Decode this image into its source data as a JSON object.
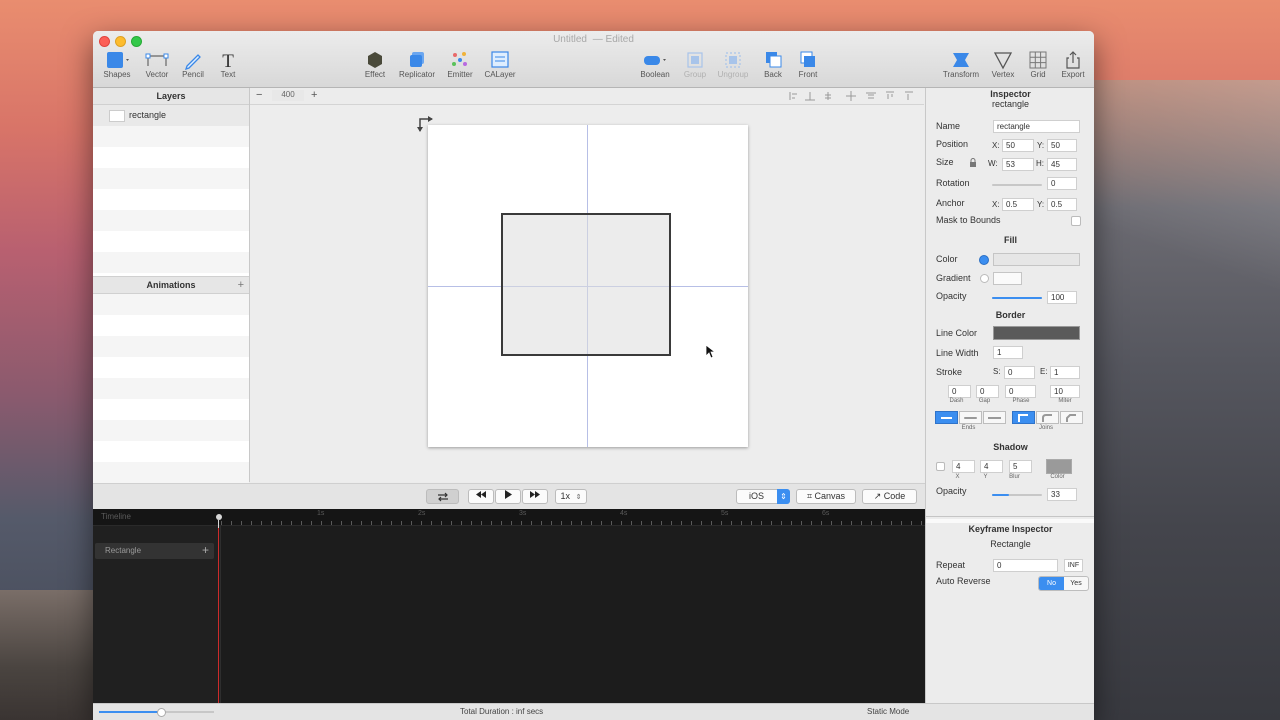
{
  "window": {
    "title": "Untitled",
    "subtitle": "— Edited"
  },
  "toolbar": {
    "shapes": "Shapes",
    "vector": "Vector",
    "pencil": "Pencil",
    "text": "Text",
    "effect": "Effect",
    "replicator": "Replicator",
    "emitter": "Emitter",
    "calayer": "CALayer",
    "boolean": "Boolean",
    "group": "Group",
    "ungroup": "Ungroup",
    "back": "Back",
    "front": "Front",
    "transform": "Transform",
    "vertex": "Vertex",
    "grid": "Grid",
    "export": "Export"
  },
  "layers": {
    "header": "Layers",
    "items": [
      {
        "name": "rectangle"
      }
    ]
  },
  "animations": {
    "header": "Animations",
    "add": "+"
  },
  "canvas": {
    "zoom_minus": "−",
    "zoom_value": "400",
    "zoom_plus": "+"
  },
  "inspector": {
    "title": "Inspector",
    "subtitle": "rectangle",
    "name_label": "Name",
    "name_value": "rectangle",
    "position_label": "Position",
    "pos_x_label": "X:",
    "pos_x": "50",
    "pos_y_label": "Y:",
    "pos_y": "50",
    "size_label": "Size",
    "w_label": "W:",
    "w": "53",
    "h_label": "H:",
    "h": "45",
    "rotation_label": "Rotation",
    "rotation": "0",
    "anchor_label": "Anchor",
    "anchor_x_label": "X:",
    "anchor_x": "0.5",
    "anchor_y_label": "Y:",
    "anchor_y": "0.5",
    "mask_label": "Mask to Bounds",
    "fill_header": "Fill",
    "color_label": "Color",
    "gradient_label": "Gradient",
    "opacity_label": "Opacity",
    "opacity": "100",
    "opacity_fraction": 1.0,
    "border_header": "Border",
    "line_color_label": "Line Color",
    "line_width_label": "Line Width",
    "line_width": "1",
    "stroke_label": "Stroke",
    "stroke_s_label": "S:",
    "stroke_s": "0",
    "stroke_e_label": "E:",
    "stroke_e": "1",
    "dash": "0",
    "gap": "0",
    "phase": "0",
    "miter": "10",
    "dash_label": "Dash",
    "gap_label": "Gap",
    "phase_label": "Phase",
    "miter_label": "Miter",
    "ends_label": "Ends",
    "joins_label": "Joins",
    "shadow_header": "Shadow",
    "shadow_x": "4",
    "shadow_y": "4",
    "shadow_blur": "5",
    "shadow_x_label": "X",
    "shadow_y_label": "Y",
    "shadow_blur_label": "Blur",
    "shadow_color_label": "Color",
    "shadow_opacity_label": "Opacity",
    "shadow_opacity": "33",
    "shadow_opacity_fraction": 0.33,
    "keyframe_title": "Keyframe Inspector",
    "keyframe_sub": "Rectangle",
    "repeat_label": "Repeat",
    "repeat_value": "0",
    "repeat_inf": "INF",
    "auto_reverse_label": "Auto Reverse",
    "no_label": "No",
    "yes_label": "Yes"
  },
  "transport": {
    "speed": "1x",
    "platform": "iOS",
    "canvas_btn": "Canvas",
    "code_btn": "Code"
  },
  "timeline": {
    "label": "Timeline",
    "ticks": [
      "1s",
      "2s",
      "3s",
      "4s",
      "5s",
      "6s"
    ],
    "track_name": "Rectangle",
    "track_add": "+"
  },
  "status": {
    "total": "Total Duration : inf secs",
    "mode": "Static Mode"
  },
  "colors": {
    "accent": "#3b8ef0",
    "timeline_bg": "#1c1c1c",
    "playhead": "#cc2b2b"
  }
}
